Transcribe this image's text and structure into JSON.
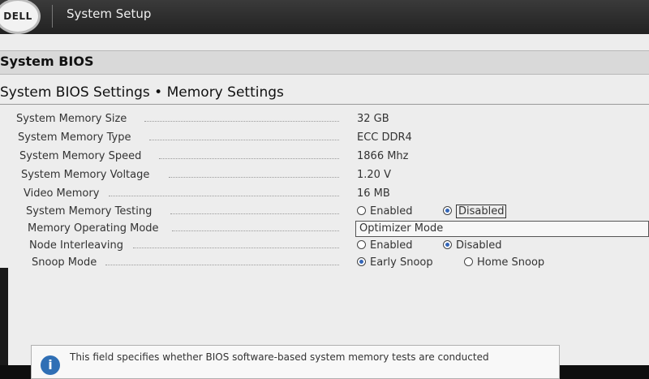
{
  "header": {
    "logo": "DELL",
    "title": "System Setup"
  },
  "section": {
    "title": "System BIOS"
  },
  "page": {
    "subtitle": "System BIOS Settings • Memory Settings"
  },
  "rows": [
    {
      "label": "System Memory Size",
      "value": "32 GB"
    },
    {
      "label": "System Memory Type",
      "value": "ECC DDR4"
    },
    {
      "label": "System Memory Speed",
      "value": "1866 Mhz"
    },
    {
      "label": "System Memory Voltage",
      "value": "1.20 V"
    },
    {
      "label": "Video Memory",
      "value": "16 MB"
    },
    {
      "label": "System Memory Testing",
      "options": [
        "Enabled",
        "Disabled"
      ],
      "selected": "Disabled"
    },
    {
      "label": "Memory Operating Mode",
      "value": "Optimizer Mode"
    },
    {
      "label": "Node Interleaving",
      "options": [
        "Enabled",
        "Disabled"
      ],
      "selected": "Disabled"
    },
    {
      "label": "Snoop Mode",
      "options": [
        "Early Snoop",
        "Home Snoop"
      ],
      "selected": "Early Snoop"
    }
  ],
  "help": {
    "icon": "info-icon",
    "text": "This field specifies whether BIOS software-based system memory tests are conducted"
  },
  "colors": {
    "accent": "#3466b8",
    "info": "#2f6fb5"
  }
}
